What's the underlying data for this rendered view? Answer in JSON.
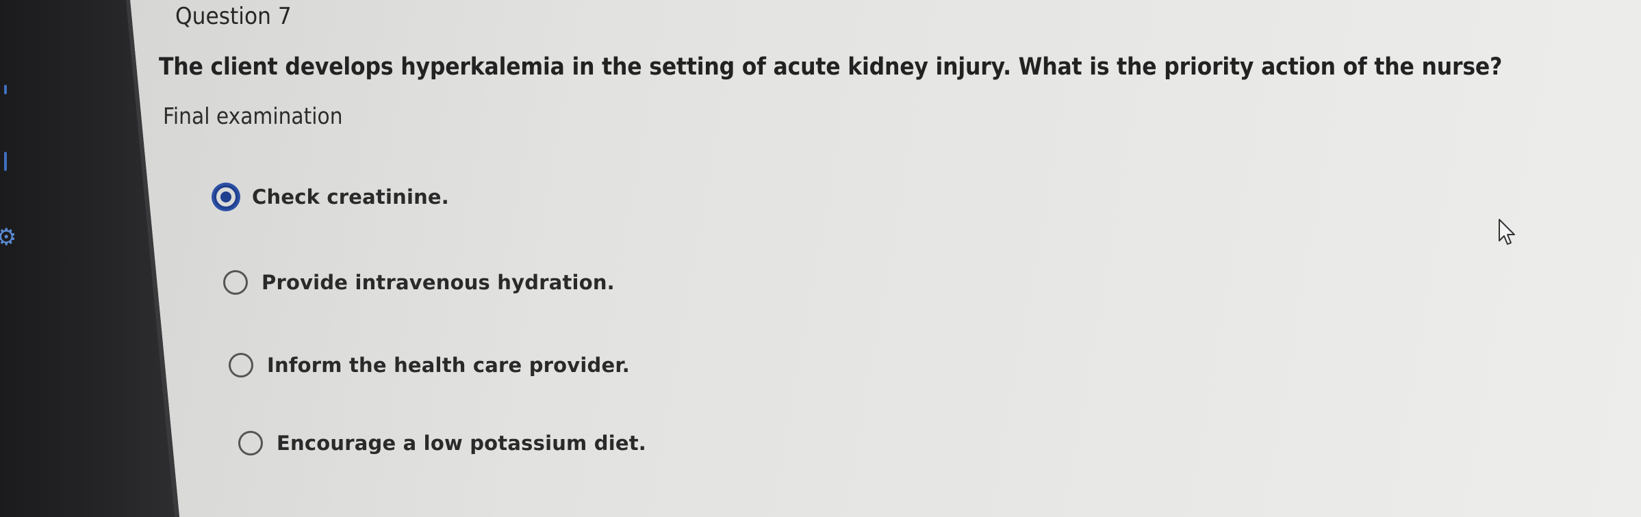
{
  "question": {
    "number_label": "Question 7",
    "text": "The client develops hyperkalemia in the setting of acute kidney injury. What is the priority action of the nurse?",
    "subtitle": "Final examination"
  },
  "options": [
    {
      "label": "Check creatinine.",
      "selected": true
    },
    {
      "label": "Provide intravenous hydration.",
      "selected": false
    },
    {
      "label": "Inform the health care provider.",
      "selected": false
    },
    {
      "label": "Encourage a low potassium diet.",
      "selected": false
    }
  ],
  "colors": {
    "selected_radio": "#1f3f8f",
    "page_background": "#e4e4e2",
    "bezel": "#222224"
  },
  "icons": {
    "left_edge": "gear-icon",
    "pointer": "mouse-cursor-icon"
  }
}
